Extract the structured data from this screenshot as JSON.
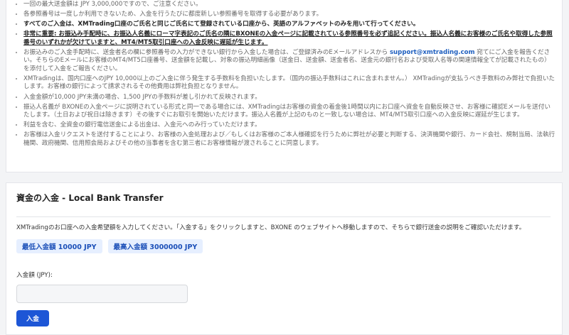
{
  "notes": {
    "items": [
      {
        "segments": [
          {
            "text": "一回の最大送金額は JPY 3,000,000ですので、ご注意ください。",
            "style": "normal"
          }
        ]
      },
      {
        "segments": [
          {
            "text": "各参照番号は一度しか利用できないため、入金を行うたびに都度新しい参照番号を取得する必要があります。",
            "style": "normal"
          }
        ]
      },
      {
        "segments": [
          {
            "text": "すべてのご入金は、XMTrading口座のご氏名と同じご氏名にて登録されている口座から、英語のアルファベットのみを用いて行ってください。",
            "style": "strong"
          }
        ]
      },
      {
        "segments": [
          {
            "text": "非常に重要: お振込み手配時に、お振込人名義にローマ字表記のご氏名の隣にBXONEの入金ページに記載されている参照番号を必ず追記ください。振込人名義にお客様のご氏名や取得した参照番号のいずれかが欠けていますと、MT4/MT5取引口座への入金反映に遅延が生じます。",
            "style": "warn"
          }
        ]
      },
      {
        "segments": [
          {
            "text": "お振込みのご入金手配時に、送金者名の欄に参照番号の入力ができない銀行から入金した場合は、ご登録済みのEメールアドレスから ",
            "style": "normal"
          },
          {
            "text": "support@xmtrading.com",
            "style": "mail"
          },
          {
            "text": " 宛てにご入金を報告ください。そちらのEメールにお客様のMT4/MT5口座番号、送金額を記載し、対象の振込明細画像（送金日、送金額、送金者名、送金元の銀行名および受取人名等の関連情報全てが記載されたもの）を添付して入金をご報告ください。",
            "style": "normal"
          }
        ]
      },
      {
        "segments": [
          {
            "text": "XMTradingは、国内口座へのJPY 10,000以上のご入金に伴う発生する手数料を負担いたします。（国内の振込手数料はこれに含まれません。） XMTradingが支払うべき手数料のみ弊社で負担いたします。お客様の銀行によって請求されるその他費用は弊社負担となりません。",
            "style": "normal"
          }
        ]
      },
      {
        "segments": [
          {
            "text": "入金金額が10,000 JPY未満の場合、1,500 JPYの手数料が差し引かれて反映されます。",
            "style": "normal"
          }
        ]
      },
      {
        "segments": [
          {
            "text": "振込人名義が BXONEの入金ページに説明されている形式と同一である場合には、XMTradingはお客様の資金の着金後1時間以内にお口座へ資金を自動反映させ、お客様に確認Eメールを送付いたします。（土日および祝日は除きます）その後すぐにお取引を開始いただけます。振込人名義が上記のものと一致しない場合は、MT4/MT5取引口座への入金反映に遅延が生じます。",
            "style": "normal"
          }
        ]
      },
      {
        "segments": [
          {
            "text": "利益を含む、全資金の銀行電信送金による出金は、入金元へのみ行っていただけます。",
            "style": "normal"
          }
        ]
      },
      {
        "segments": [
          {
            "text": "お客様は入金リクエストを送付することにより、お客様の入金処理および／もしくはお客様のご本人様確認を行うために弊社が必要と判断する、決済機関や銀行、カード会社、規制当局、法執行機関、政府機関、信用照会局およびその他の当事者を含む第三者にお客様情報が渡されることに同意します。",
            "style": "normal"
          }
        ]
      }
    ]
  },
  "deposit": {
    "title": "資金の入金 - Local Bank Transfer",
    "description": "XMTradingのお口座への入金希望額を入力してください。「入金する」をクリックしますと、BXONE のウェブサイトへ移動しますので、そちらで銀行送金の説明をご確認いただけます。",
    "min_badge": "最低入金額 10000 JPY",
    "max_badge": "最高入金額 3000000 JPY",
    "amount_label": "入金額 (JPY):",
    "amount_value": "",
    "amount_placeholder": "",
    "submit_label": "入金"
  }
}
